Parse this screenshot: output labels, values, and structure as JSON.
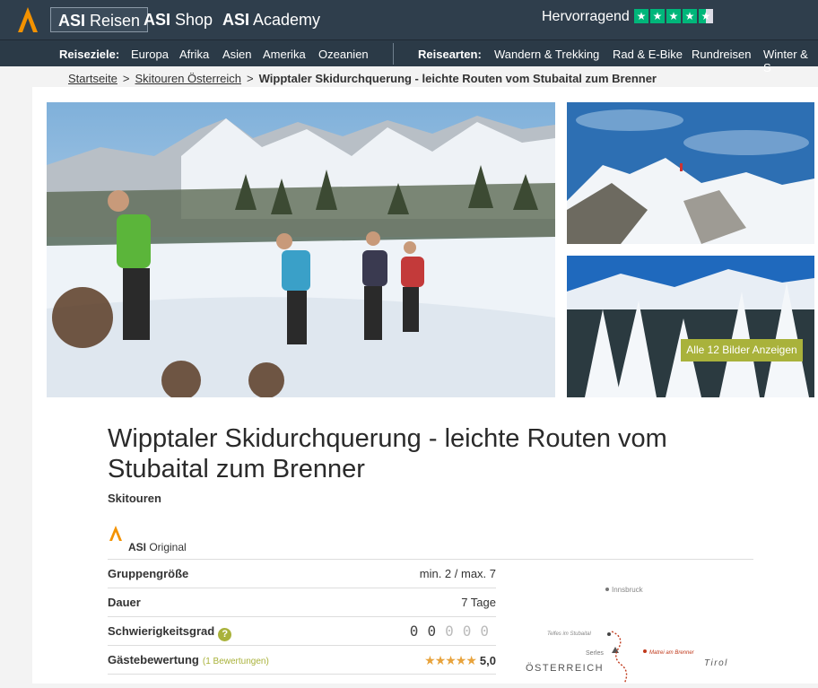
{
  "header": {
    "tabs": [
      {
        "brand": "ASI",
        "rest": " Reisen"
      },
      {
        "brand": "ASI",
        "rest": " Shop"
      },
      {
        "brand": "ASI",
        "rest": " Academy"
      }
    ],
    "rating_text": "Hervorragend",
    "trustpilot_stars": 4.5,
    "accent_color": "#f39200",
    "trust_color": "#00b67a"
  },
  "nav": {
    "destinations_label": "Reiseziele:",
    "destinations": [
      "Europa",
      "Afrika",
      "Asien",
      "Amerika",
      "Ozeanien"
    ],
    "types_label": "Reisearten:",
    "types": [
      "Wandern & Trekking",
      "Rad & E-Bike",
      "Rundreisen",
      "Winter & S"
    ]
  },
  "breadcrumb": {
    "items": [
      "Startseite",
      "Skitouren Österreich"
    ],
    "current": "Wipptaler Skidurchquerung - leichte Routen vom Stubaital zum Brenner",
    "separator": ">"
  },
  "gallery": {
    "all_images_button": "Alle 12 Bilder Anzeigen"
  },
  "product": {
    "title": "Wipptaler Skidurchquerung - leichte Routen vom Stubaital zum Brenner",
    "category": "Skitouren",
    "badge_brand": "ASI",
    "badge_text": " Original",
    "facts": {
      "group_label": "Gruppengröße",
      "group_value": "min. 2 / max. 7",
      "duration_label": "Dauer",
      "duration_value": "7 Tage",
      "difficulty_label": "Schwierigkeitsgrad",
      "difficulty_help": "?",
      "difficulty_level": 2,
      "difficulty_max": 5,
      "reviews_label": "Gästebewertung",
      "reviews_count": "(1 Bewertungen)",
      "reviews_stars": "★★★★★",
      "reviews_score": "5,0"
    }
  },
  "map": {
    "innsbruck": "Innsbruck",
    "telfes": "Telfes im Stubaital",
    "serles": "Serles",
    "matrei": "Matrei am Brenner",
    "austria": "ÖSTERREICH",
    "tirol": "Tirol"
  }
}
